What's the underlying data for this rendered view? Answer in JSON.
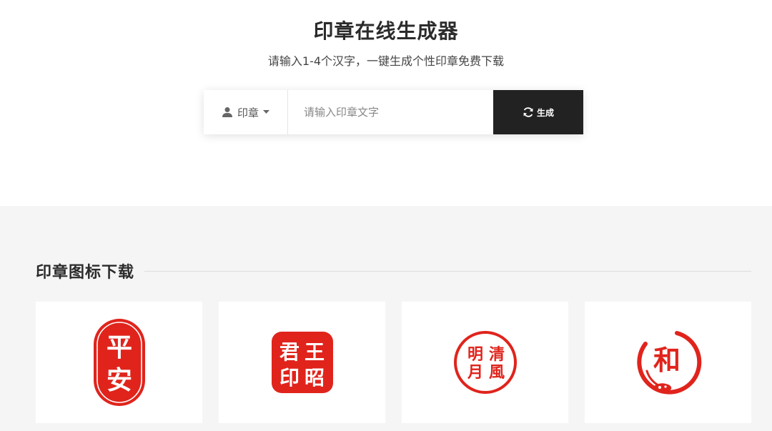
{
  "header": {
    "title": "印章在线生成器",
    "subtitle": "请输入1-4个汉字，一键生成个性印章免费下载"
  },
  "search": {
    "type_label": "印章",
    "placeholder": "请输入印章文字",
    "value": "",
    "button_label": "生成"
  },
  "gallery": {
    "title": "印章图标下载",
    "items": [
      {
        "name": "oval-seal",
        "chars": [
          "平",
          "安"
        ],
        "color": "#e0241c"
      },
      {
        "name": "square-seal",
        "chars": [
          "王",
          "昭",
          "君",
          "印"
        ],
        "color": "#e0241c"
      },
      {
        "name": "round-seal",
        "chars": [
          "清",
          "風",
          "明",
          "月"
        ],
        "color": "#e0241c"
      },
      {
        "name": "brush-circle-seal",
        "chars": [
          "和"
        ],
        "color": "#e0241c"
      }
    ]
  },
  "colors": {
    "accent": "#222222",
    "seal_red": "#e0241c",
    "gallery_bg": "#f5f5f5"
  }
}
